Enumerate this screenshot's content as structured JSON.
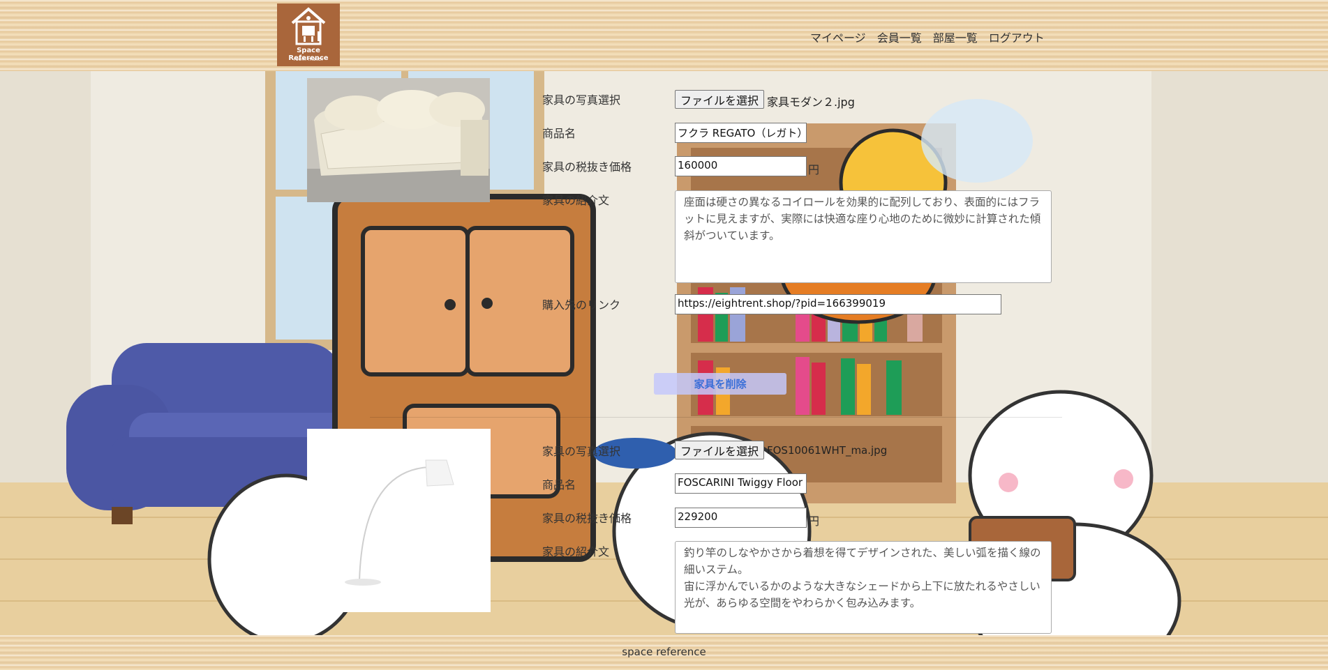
{
  "header": {
    "logo_title": "Space Reference",
    "logo_subtitle": "room maker",
    "nav": [
      "マイページ",
      "会員一覧",
      "部屋一覧",
      "ログアウト"
    ]
  },
  "items": [
    {
      "photo_label": "家具の写真選択",
      "file_button": "ファイルを選択",
      "file_name": "家具モダン２.jpg",
      "name_label": "商品名",
      "name_value": "フクラ REGATO（レガト）",
      "price_label": "家具の税抜き価格",
      "price_value": "160000",
      "yen": "円",
      "desc_label": "家具の紹介文",
      "desc_value": "座面は硬さの異なるコイロールを効果的に配列しており、表面的にはフラットに見えますが、実際には快適な座り心地のために微妙に計算された傾斜がついています。",
      "link_label": "購入先のリンク",
      "link_value": "https://eightrent.shop/?pid=166399019",
      "delete_button": "家具を削除"
    },
    {
      "photo_label": "家具の写真選択",
      "file_button": "ファイルを選択",
      "file_name": "FOS10061WHT_ma.jpg",
      "name_label": "商品名",
      "name_value": "FOSCARINI Twiggy Floor Lamp",
      "price_label": "家具の税抜き価格",
      "price_value": "229200",
      "yen": "円",
      "desc_label": "家具の紹介文",
      "desc_value": "釣り竿のしなやかさから着想を得てデザインされた、美しい弧を描く線の細いステム。\n宙に浮かんでいるかのような大きなシェードから上下に放たれるやさしい光が、あらゆる空間をやわらかく包み込みます。"
    }
  ],
  "footer": {
    "text": "space reference"
  },
  "colors": {
    "logo_bg": "#a9663b",
    "wood": "#eed7b0",
    "delete_btn": "#c4c8fa",
    "delete_text": "#3a6fd8"
  }
}
